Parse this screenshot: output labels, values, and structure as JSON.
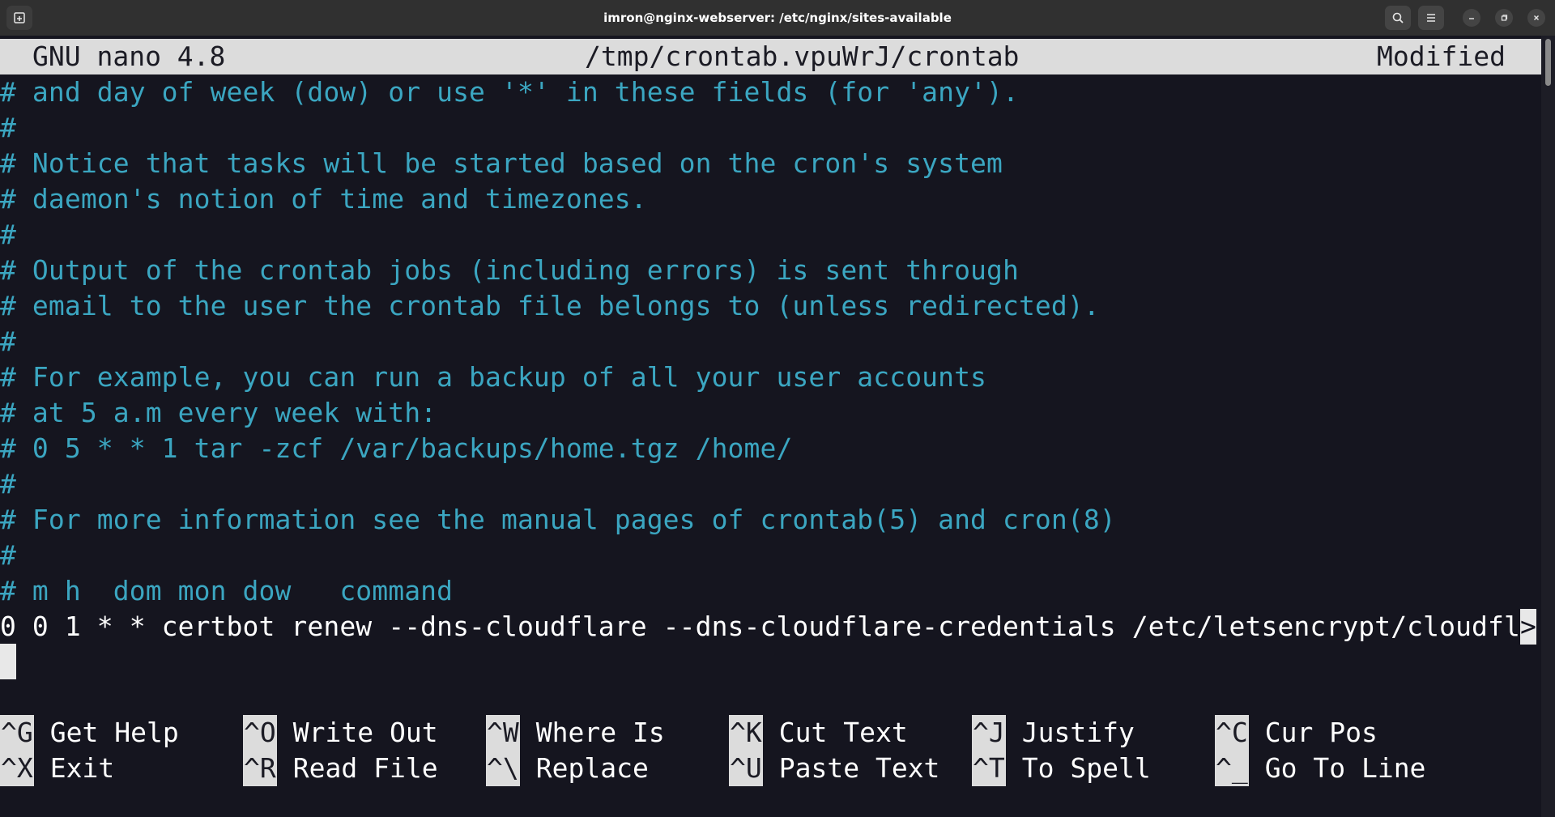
{
  "window": {
    "title": "imron@nginx-webserver: /etc/nginx/sites-available"
  },
  "nano": {
    "version": "GNU nano 4.8",
    "filename": "/tmp/crontab.vpuWrJ/crontab",
    "status": "Modified"
  },
  "lines": [
    "# and day of week (dow) or use '*' in these fields (for 'any').",
    "#",
    "# Notice that tasks will be started based on the cron's system",
    "# daemon's notion of time and timezones.",
    "#",
    "# Output of the crontab jobs (including errors) is sent through",
    "# email to the user the crontab file belongs to (unless redirected).",
    "#",
    "# For example, you can run a backup of all your user accounts",
    "# at 5 a.m every week with:",
    "# 0 5 * * 1 tar -zcf /var/backups/home.tgz /home/",
    "#",
    "# For more information see the manual pages of crontab(5) and cron(8)",
    "#",
    "# m h  dom mon dow   command"
  ],
  "cron_line": "0 0 1 * * certbot renew --dns-cloudflare --dns-cloudflare-credentials /etc/letsencrypt/cloudfl",
  "overflow_marker": ">",
  "shortcuts": {
    "row1": [
      {
        "key": "^G",
        "label": "Get Help"
      },
      {
        "key": "^O",
        "label": "Write Out"
      },
      {
        "key": "^W",
        "label": "Where Is"
      },
      {
        "key": "^K",
        "label": "Cut Text"
      },
      {
        "key": "^J",
        "label": "Justify"
      },
      {
        "key": "^C",
        "label": "Cur Pos"
      }
    ],
    "row2": [
      {
        "key": "^X",
        "label": "Exit"
      },
      {
        "key": "^R",
        "label": "Read File"
      },
      {
        "key": "^\\",
        "label": "Replace"
      },
      {
        "key": "^U",
        "label": "Paste Text"
      },
      {
        "key": "^T",
        "label": "To Spell"
      },
      {
        "key": "^_",
        "label": "Go To Line"
      }
    ]
  }
}
